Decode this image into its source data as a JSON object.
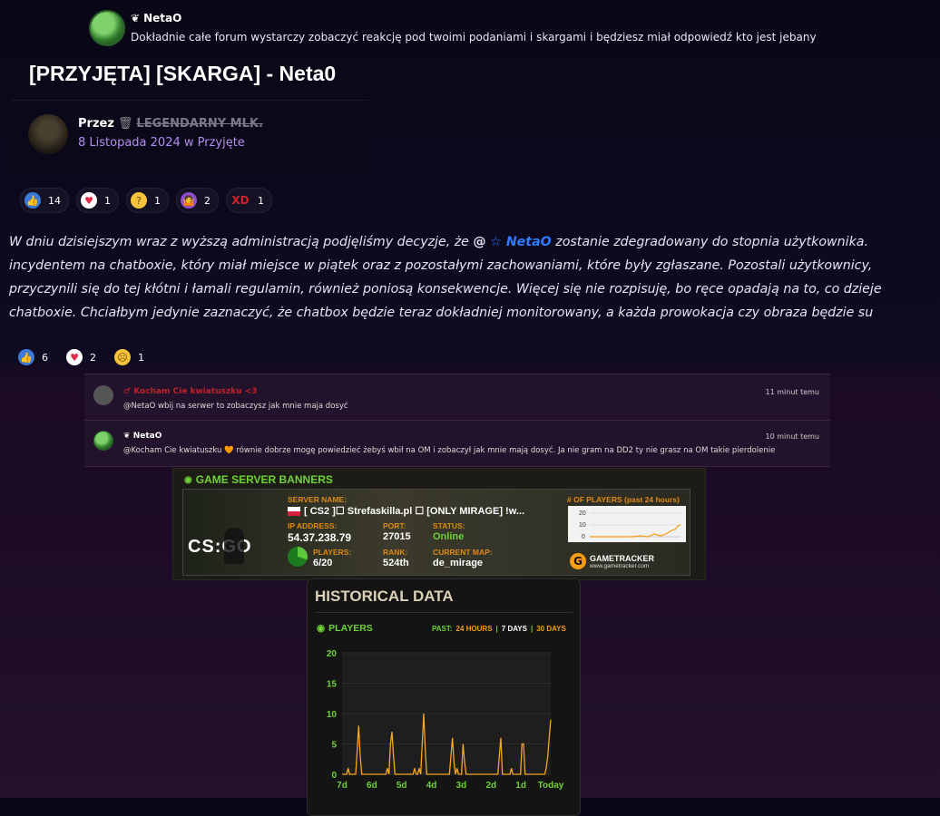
{
  "top_comment": {
    "name": "NetaO",
    "text": "Dokładnie całe forum wystarczy zobaczyć reakcję pod twoimi podaniami i skargami i będziesz miał odpowiedź kto jest jebany"
  },
  "topic": {
    "title": "[PRZYJĘTA] [SKARGA] - Neta0",
    "by_prefix": "Przez",
    "author": "LEGENDARNY MLK.",
    "date_line": "8 Listopada 2024 w Przyjęte"
  },
  "reactions_top": [
    {
      "icon": "like-icon",
      "count": "14"
    },
    {
      "icon": "heart-icon",
      "count": "1"
    },
    {
      "icon": "thinking-icon",
      "count": "1"
    },
    {
      "icon": "shrug-icon",
      "count": "2"
    },
    {
      "icon": "xd-icon",
      "label": "XD",
      "count": "1"
    }
  ],
  "post": {
    "l1a": "W dniu dzisiejszym wraz z wyższą administracją podjęliśmy decyzje, że ",
    "mention_at": "@",
    "mention": "NetaO",
    "l1b": " zostanie zdegradowany do stopnia użytkownika.",
    "l2": "incydentem na chatboxie, który miał miejsce w piątek oraz z pozostałymi zachowaniami, które były zgłaszane. Pozostali użytkownicy,",
    "l3": "przyczynili się do tej kłótni i łamali regulamin, również poniosą konsekwencje. Więcej się nie rozpisuję, bo ręce opadają na to, co dzieje",
    "l4": "chatboxie. Chciałbym jedynie zaznaczyć, że chatbox będzie teraz dokładniej monitorowany, a każda prowokacja czy obraza będzie su"
  },
  "reactions_post": [
    {
      "icon": "like-icon",
      "count": "6"
    },
    {
      "icon": "heart-icon",
      "count": "2"
    },
    {
      "icon": "sad-icon",
      "count": "1"
    }
  ],
  "chat": [
    {
      "name": "Kocham Cie kwiatuszku <3",
      "time": "11 minut temu",
      "msg": "@NetaO wbij na serwer to zobaczysz jak mnie maja dosyć",
      "color": "#c0202a"
    },
    {
      "name": "NetaO",
      "time": "10 minut temu",
      "msg": "@Kocham Cie kwiatuszku 🧡 równie dobrze mogę powiedzieć żebyś wbił na OM i zobaczył jak mnie mają dosyć. Ja nie gram na DD2 ty nie grasz na OM takie pierdolenie",
      "color": "#ffffff"
    }
  ],
  "gametracker": {
    "section": "GAME SERVER BANNERS",
    "server_name_label": "SERVER NAME:",
    "server_name": "[ CS2 ]☐ Strefaskilla.pl ☐ [ONLY MIRAGE] !w...",
    "ip_label": "IP ADDRESS:",
    "ip": "54.37.238.79",
    "port_label": "PORT:",
    "port": "27015",
    "status_label": "STATUS:",
    "status": "Online",
    "players_label": "PLAYERS:",
    "players": "6/20",
    "rank_label": "RANK:",
    "rank": "524th",
    "map_label": "CURRENT MAP:",
    "map": "de_mirage",
    "graph_label": "# OF PLAYERS (past 24 hours)",
    "logo_text": "CS:GO",
    "brand": "GAMETRACKER",
    "brand_url": "www.gametracker.com",
    "mini_ticks": [
      "20",
      "10",
      "0"
    ]
  },
  "historical": {
    "title": "HISTORICAL DATA",
    "players_label": "PLAYERS",
    "past_label": "PAST:",
    "opt1": "24 HOURS",
    "opt2": "7 DAYS",
    "opt3": "30 DAYS",
    "sep": "|"
  },
  "chart_data": {
    "type": "line",
    "ylim": [
      0,
      20
    ],
    "yticks": [
      "20",
      "15",
      "10",
      "5",
      "0"
    ],
    "xticks": [
      "7d",
      "6d",
      "5d",
      "4d",
      "3d",
      "2d",
      "1d",
      "Today"
    ],
    "series": [
      {
        "values": [
          0,
          0,
          0,
          0,
          1,
          0,
          0,
          0,
          0,
          0,
          4,
          8,
          3,
          0,
          0,
          0,
          0,
          0,
          0,
          0,
          0,
          0,
          0,
          0,
          0,
          0,
          0,
          0,
          0,
          0,
          1,
          0,
          5,
          7,
          3,
          0,
          0,
          0,
          0,
          0,
          0,
          0,
          0,
          0,
          0,
          0,
          0,
          0,
          1,
          0,
          0,
          1,
          0,
          5,
          10,
          4,
          0,
          0,
          0,
          0,
          0,
          0,
          0,
          0,
          0,
          0,
          0,
          0,
          0,
          0,
          0,
          0,
          3,
          6,
          2,
          0,
          1,
          0,
          0,
          0,
          5,
          2,
          0,
          0,
          0,
          0,
          0,
          0,
          0,
          0,
          0,
          0,
          0,
          0,
          0,
          0,
          0,
          0,
          0,
          0,
          0,
          0,
          0,
          0,
          3,
          6,
          0,
          0,
          0,
          0,
          0,
          0,
          1,
          0,
          0,
          0,
          0,
          0,
          0,
          5,
          5,
          0,
          0,
          0,
          0,
          0,
          0,
          0,
          0,
          0,
          0,
          0,
          0,
          0,
          0,
          1,
          3,
          6,
          9
        ]
      }
    ],
    "color": "#f5a623"
  }
}
